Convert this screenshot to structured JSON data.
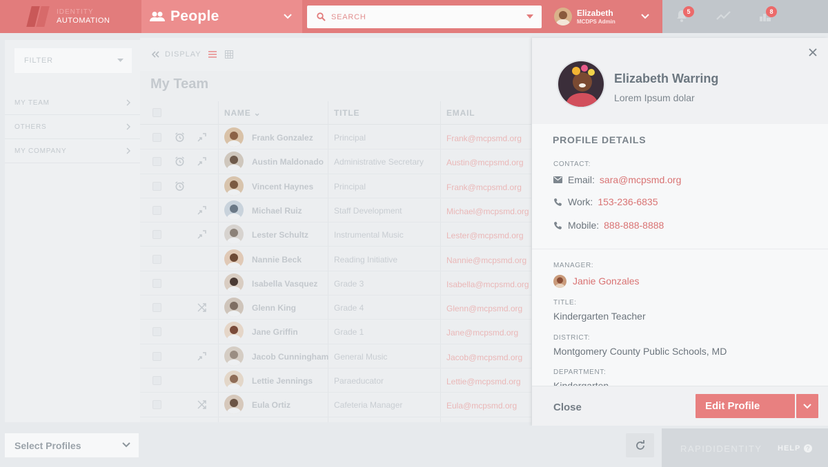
{
  "header": {
    "logo_line1": "IDENTITY",
    "logo_line2": "AUTOMATION",
    "module_title": "People",
    "search_placeholder": "SEARCH",
    "user_name": "Elizabeth",
    "user_role": "MCDPS Admin",
    "notifications_count": "5",
    "tasks_count": "8"
  },
  "sidebar": {
    "filter_placeholder": "FILTER",
    "items": [
      {
        "label": "MY TEAM"
      },
      {
        "label": "OTHERS"
      },
      {
        "label": "MY COMPANY"
      }
    ],
    "select_profiles": "Select Profiles"
  },
  "list": {
    "display_label": "DISPLAY",
    "title": "My Team",
    "columns": {
      "name": "NAME",
      "title": "TITLE",
      "email": "EMAIL"
    },
    "rows": [
      {
        "name": "Frank Gonzalez",
        "title": "Principal",
        "email": "Frank@mcpsmd.org",
        "alarm": true,
        "action": "assign"
      },
      {
        "name": "Austin Maldonado",
        "title": "Administrative Secretary",
        "email": "Austin@mcpsmd.org",
        "alarm": true,
        "action": "assign"
      },
      {
        "name": "Vincent Haynes",
        "title": "Principal",
        "email": "Frank@mcpsmd.org",
        "alarm": true,
        "action": ""
      },
      {
        "name": "Michael Ruiz",
        "title": "Staff Development",
        "email": "Michael@mcpsmd.org",
        "alarm": false,
        "action": "assign"
      },
      {
        "name": "Lester Schultz",
        "title": "Instrumental Music",
        "email": "Lester@mcpsmd.org",
        "alarm": false,
        "action": "assign"
      },
      {
        "name": "Nannie Beck",
        "title": "Reading Initiative",
        "email": "Nannie@mcpsmd.org",
        "alarm": false,
        "action": ""
      },
      {
        "name": "Isabella Vasquez",
        "title": "Grade 3",
        "email": "Isabella@mcpsmd.org",
        "alarm": false,
        "action": ""
      },
      {
        "name": "Glenn King",
        "title": "Grade 4",
        "email": "Glenn@mcpsmd.org",
        "alarm": false,
        "action": "shuffle"
      },
      {
        "name": "Jane Griffin",
        "title": "Grade 1",
        "email": "Jane@mcpsmd.org",
        "alarm": false,
        "action": ""
      },
      {
        "name": "Jacob Cunningham",
        "title": "General Music",
        "email": "Jacob@mcpsmd.org",
        "alarm": false,
        "action": "assign"
      },
      {
        "name": "Lettie Jennings",
        "title": "Paraeducator",
        "email": "Lettie@mcpsmd.org",
        "alarm": false,
        "action": ""
      },
      {
        "name": "Eula Ortiz",
        "title": "Cafeteria Manager",
        "email": "Eula@mcpsmd.org",
        "alarm": false,
        "action": "shuffle"
      }
    ]
  },
  "profile": {
    "name": "Elizabeth Warring",
    "subtitle": "Lorem Ipsum dolar",
    "section_title": "PROFILE DETAILS",
    "contact_label": "CONTACT:",
    "email_key": "Email:",
    "email": "sara@mcpsmd.org",
    "work_key": "Work:",
    "work": "153-236-6835",
    "mobile_key": "Mobile:",
    "mobile": "888-888-8888",
    "manager_label": "MANAGER:",
    "manager": "Janie Gonzales",
    "title_label": "TITLE:",
    "title": "Kindergarten Teacher",
    "district_label": "DISTRICT:",
    "district": "Montgomery County Public Schools, MD",
    "department_label": "DEPARTMENT:",
    "department": "Kindergarten",
    "close_label": "Close",
    "edit_label": "Edit Profile"
  },
  "footer": {
    "brand": "RAPIDIDENTITY",
    "help": "HELP"
  },
  "colors": {
    "accent": "#e27c7c",
    "accent_light": "#ec8e8e",
    "link": "#d97373"
  }
}
